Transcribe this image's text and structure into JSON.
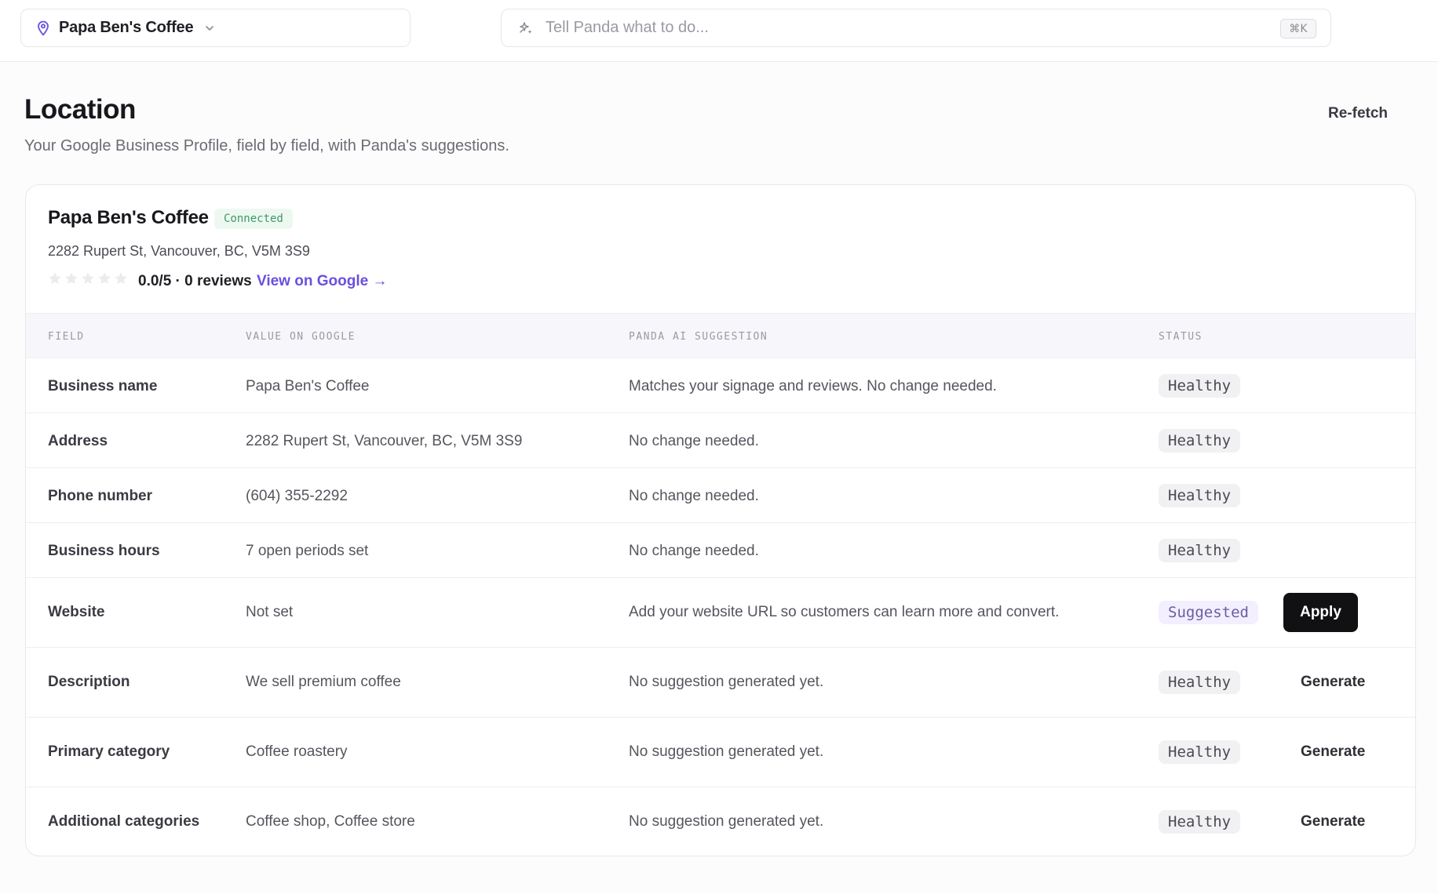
{
  "header": {
    "location_name": "Papa Ben's Coffee",
    "command_placeholder": "Tell Panda what to do...",
    "shortcut": "⌘K"
  },
  "page": {
    "title": "Location",
    "subtitle": "Your Google Business Profile, field by field, with Panda's suggestions.",
    "refetch_label": "Re-fetch"
  },
  "profile": {
    "name": "Papa Ben's Coffee",
    "connection_status": "Connected",
    "address": "2282 Rupert St, Vancouver, BC, V5M 3S9",
    "rating_value": 0,
    "rating_text": "0.0/5 · 0 reviews",
    "view_link": "View on Google →"
  },
  "table": {
    "headers": {
      "field": "FIELD",
      "value": "VALUE ON GOOGLE",
      "suggestion": "PANDA AI SUGGESTION",
      "status": "STATUS"
    },
    "rows": [
      {
        "field": "Business name",
        "value": "Papa Ben's Coffee",
        "suggestion": "Matches your signage and reviews. No change needed.",
        "status": "Healthy"
      },
      {
        "field": "Address",
        "value": "2282 Rupert St, Vancouver, BC, V5M 3S9",
        "suggestion": "No change needed.",
        "status": "Healthy"
      },
      {
        "field": "Phone number",
        "value": "(604) 355-2292",
        "suggestion": "No change needed.",
        "status": "Healthy"
      },
      {
        "field": "Business hours",
        "value": "7 open periods set",
        "suggestion": "No change needed.",
        "status": "Healthy"
      },
      {
        "field": "Website",
        "value": "Not set",
        "suggestion": "Add your website URL so customers can learn more and convert.",
        "status": "Suggested",
        "action": "Apply"
      },
      {
        "field": "Description",
        "value": "We sell premium coffee",
        "suggestion": "No suggestion generated yet.",
        "status": "Healthy",
        "action": "Generate"
      },
      {
        "field": "Primary category",
        "value": "Coffee roastery",
        "suggestion": "No suggestion generated yet.",
        "status": "Healthy",
        "action": "Generate"
      },
      {
        "field": "Additional categories",
        "value": "Coffee shop, Coffee store",
        "suggestion": "No suggestion generated yet.",
        "status": "Healthy",
        "action": "Generate"
      }
    ]
  },
  "colors": {
    "accent": "#6a4fe0",
    "connected_bg": "#edf8f1",
    "connected_text": "#3e9a66",
    "apply_bg": "#111114"
  },
  "icons": {
    "location": "map-pin-icon",
    "dropdown": "chevron-down-icon",
    "ai": "sparkle-icon",
    "rating": "star-icon"
  }
}
